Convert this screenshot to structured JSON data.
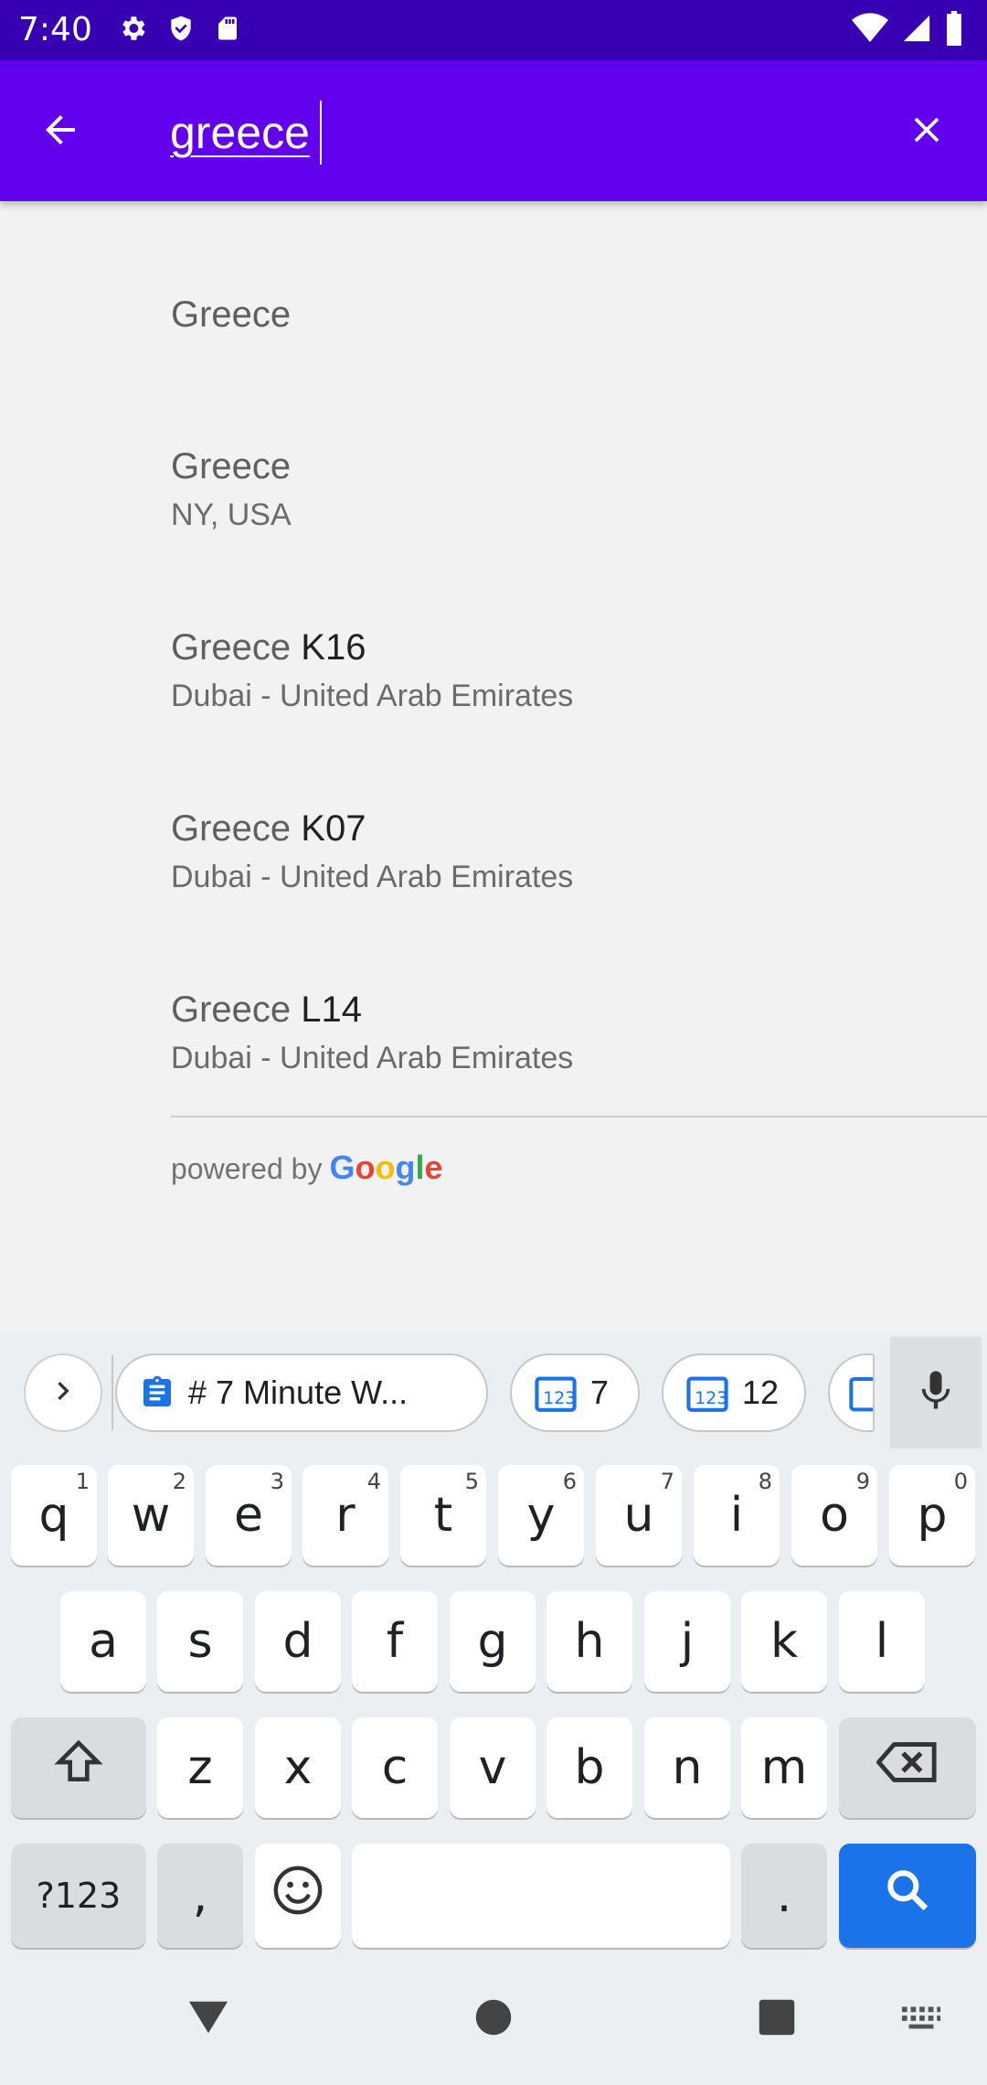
{
  "status_bar": {
    "time": "7:40",
    "left_icons": [
      "settings-icon",
      "shield-icon",
      "sd-card-icon"
    ],
    "right_icons": [
      "wifi-icon",
      "signal-icon",
      "battery-icon"
    ]
  },
  "search": {
    "query": "greece"
  },
  "results": [
    {
      "main_match": "Greece",
      "main_rest": "",
      "secondary": ""
    },
    {
      "main_match": "Greece",
      "main_rest": "",
      "secondary": "NY, USA"
    },
    {
      "main_match": "Greece",
      "main_rest": " K16",
      "secondary": "Dubai - United Arab Emirates"
    },
    {
      "main_match": "Greece",
      "main_rest": " K07",
      "secondary": "Dubai - United Arab Emirates"
    },
    {
      "main_match": "Greece",
      "main_rest": " L14",
      "secondary": "Dubai - United Arab Emirates"
    }
  ],
  "attribution": {
    "prefix": "powered by",
    "brand_letters": [
      "G",
      "o",
      "o",
      "g",
      "l",
      "e"
    ],
    "brand_colors": [
      "#4285f4",
      "#ea4335",
      "#fbbc05",
      "#4285f4",
      "#34a853",
      "#ea4335"
    ]
  },
  "keyboard": {
    "clipboard_chips": [
      "# 7 Minute W...",
      "7",
      "12"
    ],
    "row1": [
      {
        "key": "q",
        "hint": "1"
      },
      {
        "key": "w",
        "hint": "2"
      },
      {
        "key": "e",
        "hint": "3"
      },
      {
        "key": "r",
        "hint": "4"
      },
      {
        "key": "t",
        "hint": "5"
      },
      {
        "key": "y",
        "hint": "6"
      },
      {
        "key": "u",
        "hint": "7"
      },
      {
        "key": "i",
        "hint": "8"
      },
      {
        "key": "o",
        "hint": "9"
      },
      {
        "key": "p",
        "hint": "0"
      }
    ],
    "row2": [
      "a",
      "s",
      "d",
      "f",
      "g",
      "h",
      "j",
      "k",
      "l"
    ],
    "row3": [
      "z",
      "x",
      "c",
      "v",
      "b",
      "n",
      "m"
    ],
    "symbols_key": "?123",
    "comma_key": ",",
    "period_key": "."
  },
  "colors": {
    "status_bar": "#3700b3",
    "app_bar": "#6200ee",
    "search_key": "#1a73e8"
  }
}
